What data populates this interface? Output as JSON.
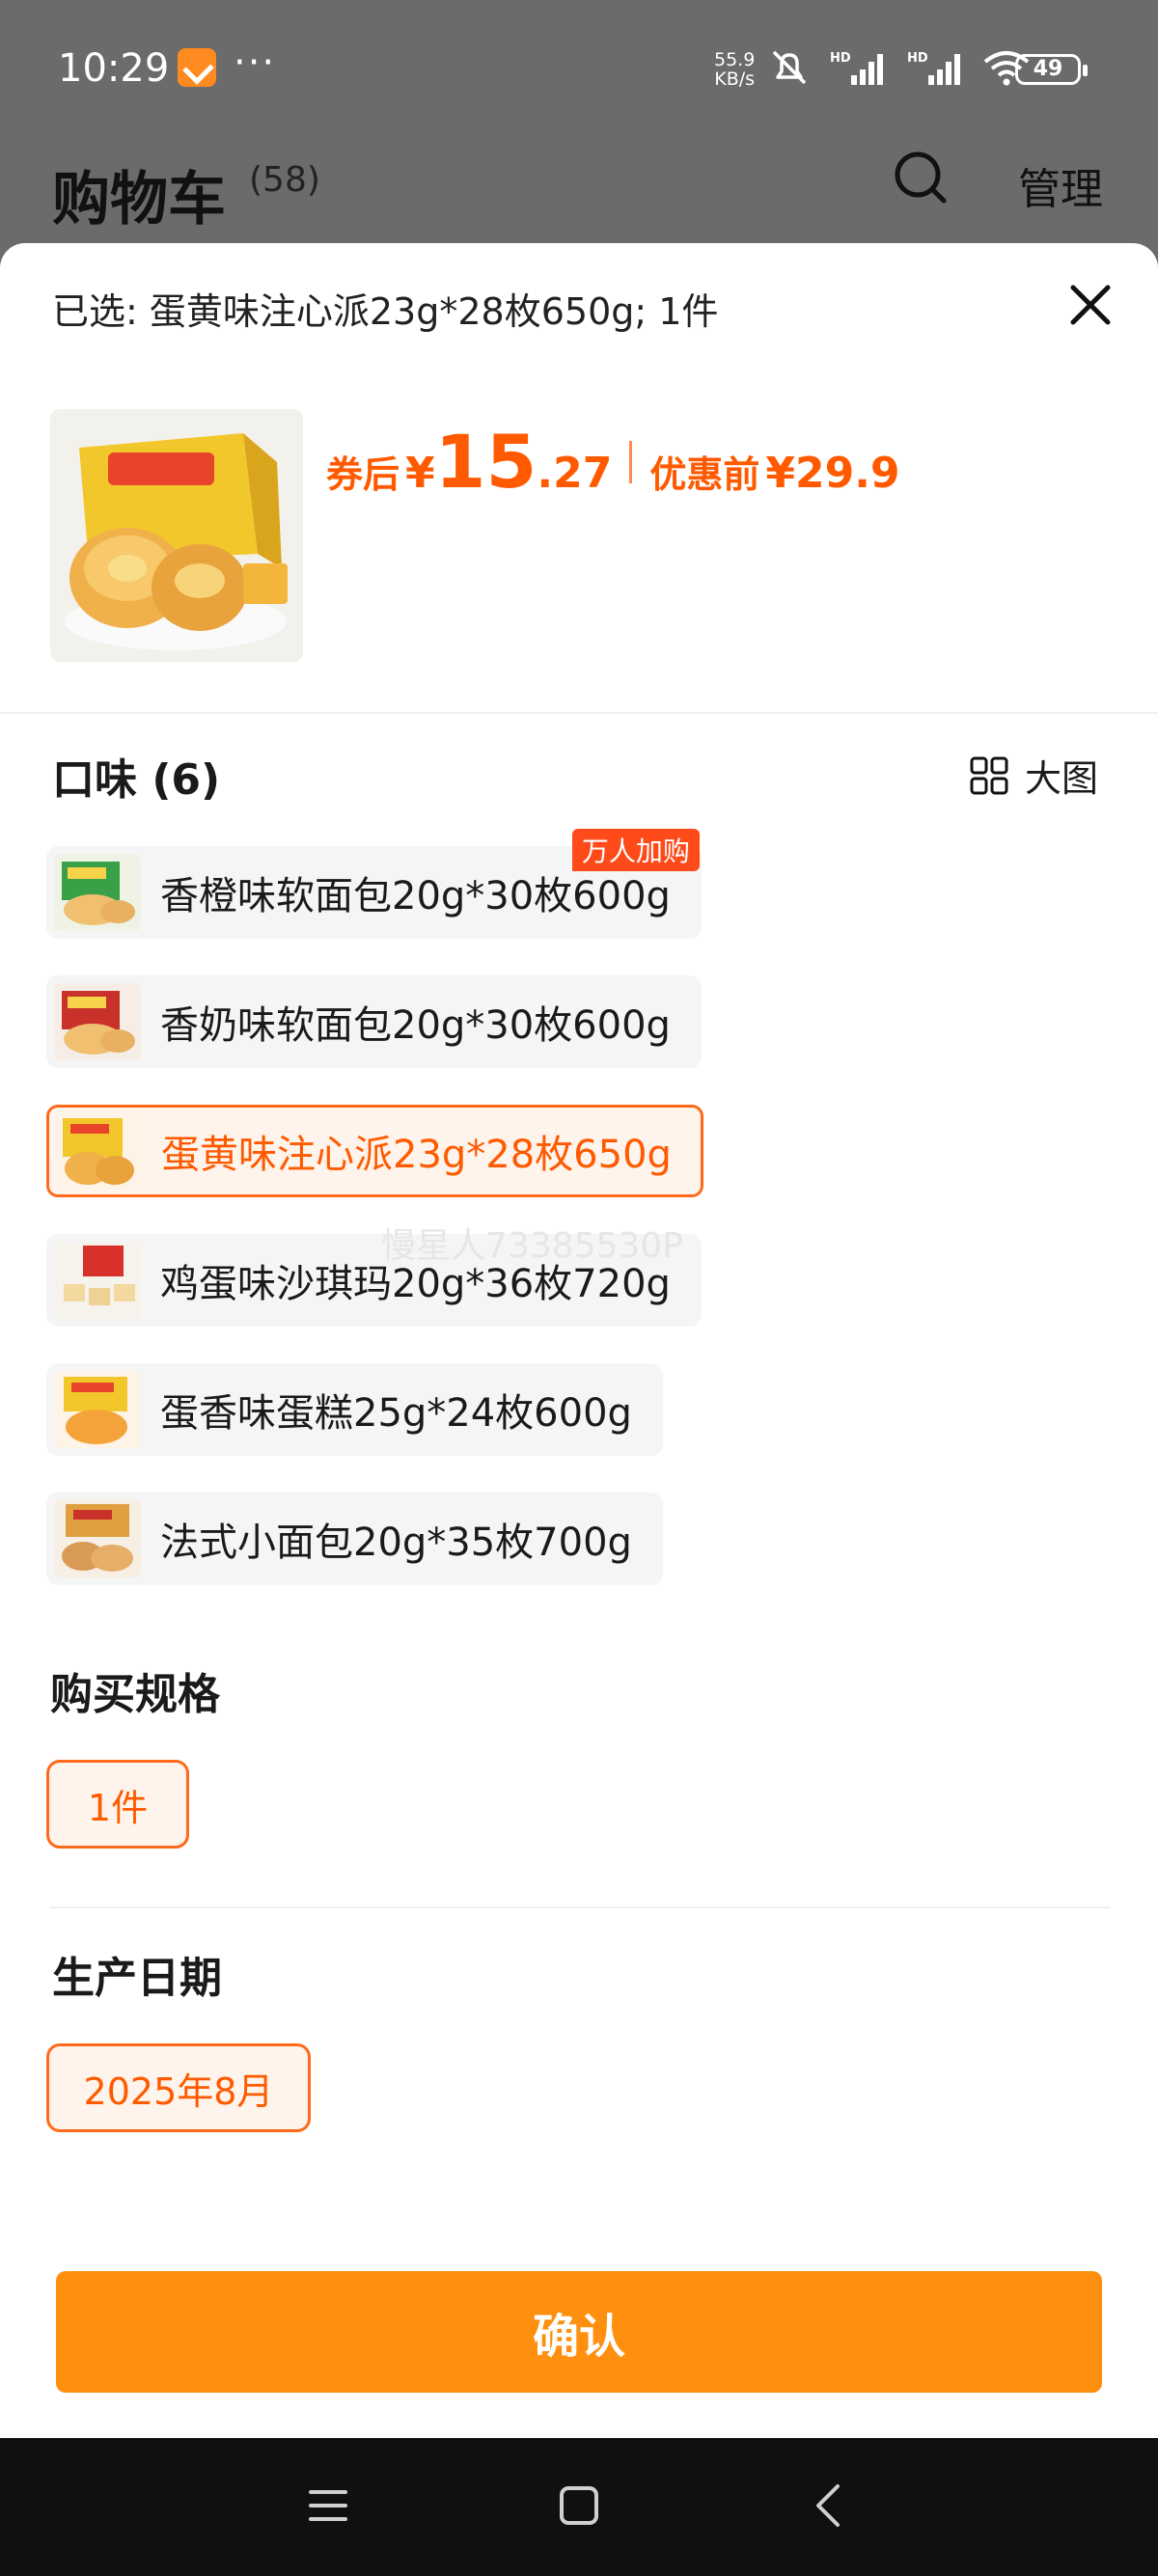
{
  "status": {
    "time": "10:29",
    "more": "···",
    "speed_value": "55.9",
    "speed_unit": "KB/s",
    "hd1": "HD",
    "hd2": "HD",
    "battery": "49"
  },
  "cart": {
    "title": "购物车",
    "count": "(58)",
    "manage": "管理"
  },
  "sheet": {
    "selected": "已选: 蛋黄味注心派23g*28枚650g; 1件",
    "price_label": "券后",
    "price_yen": "¥",
    "price_int": "15",
    "price_dec": ".27",
    "original_label": "优惠前",
    "original_price": "¥29.9",
    "flavor_title": "口味 (6)",
    "big_image_label": "大图",
    "flavors": [
      {
        "label": "香橙味软面包20g*30枚600g",
        "badge": "万人加购",
        "selected": false
      },
      {
        "label": "香奶味软面包20g*30枚600g",
        "badge": "",
        "selected": false
      },
      {
        "label": "蛋黄味注心派23g*28枚650g",
        "badge": "",
        "selected": true
      },
      {
        "label": "鸡蛋味沙琪玛20g*36枚720g",
        "badge": "",
        "selected": false
      },
      {
        "label": "蛋香味蛋糕25g*24枚600g",
        "badge": "",
        "selected": false
      },
      {
        "label": "法式小面包20g*35枚700g",
        "badge": "",
        "selected": false
      }
    ],
    "watermark": "慢星人73385530P",
    "spec_title": "购买规格",
    "spec_value": "1件",
    "date_title": "生产日期",
    "date_value": "2025年8月",
    "confirm": "确认"
  },
  "colors": {
    "accent": "#ff5a00",
    "confirm_bg": "#ff8f0f",
    "overlay": "#6b6b6b"
  },
  "icons": [
    "search-icon",
    "close-icon",
    "grid-icon",
    "menu-icon",
    "home-icon",
    "back-icon",
    "bell-mute-icon",
    "signal-icon",
    "wifi-icon",
    "battery-icon"
  ]
}
